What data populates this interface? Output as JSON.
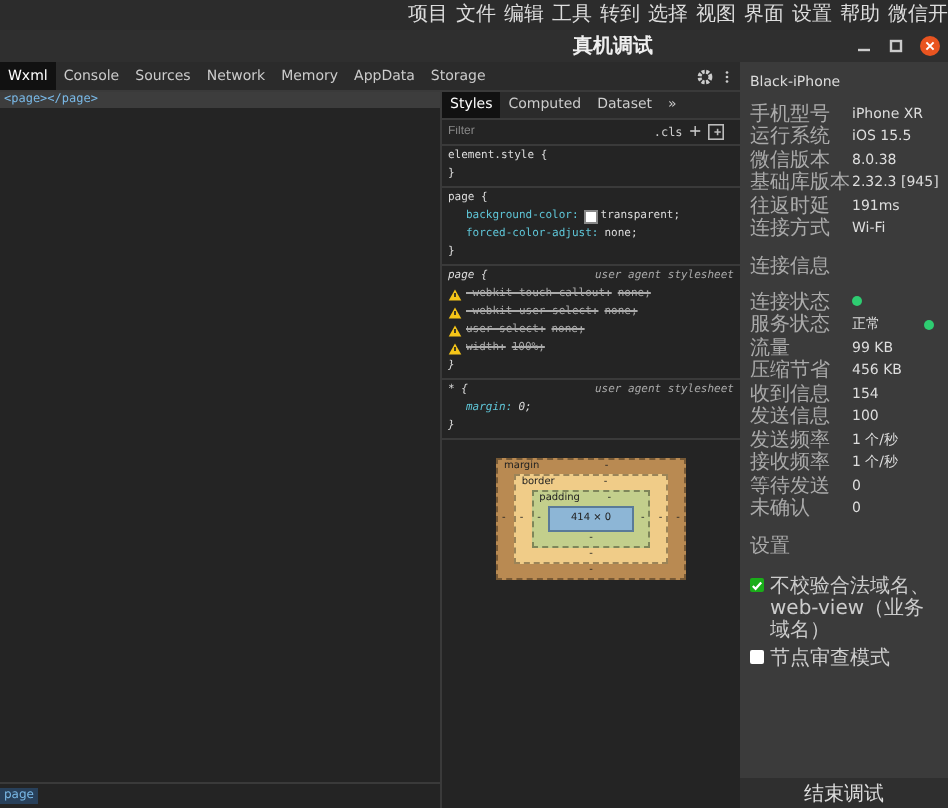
{
  "menu_bar": {
    "items": [
      "项目",
      "文件",
      "编辑",
      "工具",
      "转到",
      "选择",
      "视图",
      "界面",
      "设置",
      "帮助",
      "微信开"
    ]
  },
  "window": {
    "title": "真机调试"
  },
  "tabs": [
    {
      "label": "Wxml",
      "selected": true
    },
    {
      "label": "Console",
      "selected": false
    },
    {
      "label": "Sources",
      "selected": false
    },
    {
      "label": "Network",
      "selected": false
    },
    {
      "label": "Memory",
      "selected": false
    },
    {
      "label": "AppData",
      "selected": false
    },
    {
      "label": "Storage",
      "selected": false
    }
  ],
  "wxml": {
    "line": "<page></page>",
    "breadcrumb": "page"
  },
  "styles_tabs": [
    {
      "label": "Styles",
      "selected": true
    },
    {
      "label": "Computed",
      "selected": false
    },
    {
      "label": "Dataset",
      "selected": false
    },
    {
      "label": "»",
      "selected": false
    }
  ],
  "filter": {
    "placeholder": "Filter",
    "cls": ".cls",
    "add": "+"
  },
  "rules": [
    {
      "selector": "element.style {",
      "close": "}"
    },
    {
      "selector": "page {",
      "decls": [
        {
          "prop": "background-color:",
          "value": "transparent;",
          "swatch": true,
          "struck": false,
          "warning": false
        },
        {
          "prop": "forced-color-adjust:",
          "value": "none;",
          "swatch": false,
          "struck": false,
          "warning": false
        }
      ],
      "close": "}"
    },
    {
      "selector": "page {",
      "origin": "user agent stylesheet",
      "decls": [
        {
          "prop": "-webkit-touch-callout:",
          "value": "none;",
          "swatch": false,
          "struck": true,
          "warning": true
        },
        {
          "prop": "-webkit-user-select:",
          "value": "none;",
          "swatch": false,
          "struck": true,
          "warning": true
        },
        {
          "prop": "user-select:",
          "value": "none;",
          "swatch": false,
          "struck": true,
          "warning": true
        },
        {
          "prop": "width:",
          "value": "100%;",
          "swatch": false,
          "struck": true,
          "warning": true
        }
      ],
      "close": "}"
    },
    {
      "selector": "* {",
      "origin": "user agent stylesheet",
      "decls": [
        {
          "prop": "margin:",
          "value": "0;",
          "swatch": false,
          "struck": false,
          "warning": false
        }
      ],
      "close": "}"
    }
  ],
  "box_model": {
    "layers": [
      {
        "label": "margin",
        "top": "-",
        "left": "-"
      },
      {
        "label": "border",
        "top": "-",
        "left": "-"
      },
      {
        "label": "padding",
        "top": "-",
        "left": "-"
      }
    ],
    "content": "414 × 0",
    "right_values": [
      "-",
      "-",
      "-"
    ],
    "bottom_values": [
      "-",
      "-",
      "-"
    ]
  },
  "device": {
    "name": "Black-iPhone",
    "info": [
      {
        "label": "手机型号",
        "value": "iPhone XR"
      },
      {
        "label": "运行系统",
        "value": "iOS 15.5"
      },
      {
        "label": "微信版本",
        "value": "8.0.38"
      },
      {
        "label": "基础库版本",
        "value": "2.32.3 [945]"
      },
      {
        "label": "往返时延",
        "value": "191ms"
      },
      {
        "label": "连接方式",
        "value": "Wi-Fi"
      }
    ],
    "connection_title": "连接信息",
    "connection": [
      {
        "label": "连接状态",
        "kind": "dot",
        "color": "#2ecc71"
      },
      {
        "label": "服务状态",
        "value": "正常",
        "kind": "dot",
        "color": "#2ecc71"
      },
      {
        "label": "流量",
        "value": "99 KB",
        "kind": "text"
      },
      {
        "label": "压缩节省",
        "value": "456 KB",
        "kind": "text"
      },
      {
        "label": "收到信息",
        "value": "154",
        "kind": "text"
      },
      {
        "label": "发送信息",
        "value": "100",
        "kind": "text"
      },
      {
        "label": "发送频率",
        "value": "1 个/秒",
        "kind": "text"
      },
      {
        "label": "接收频率",
        "value": "1 个/秒",
        "kind": "text"
      },
      {
        "label": "等待发送",
        "value": "0",
        "kind": "text"
      },
      {
        "label": "未确认",
        "value": "0",
        "kind": "text"
      }
    ],
    "settings_title": "设置",
    "settings": [
      {
        "label": "不校验合法域名、web-view（业务域名）",
        "checked": true
      },
      {
        "label": "节点审查模式",
        "checked": false
      }
    ],
    "end_button": "结束调试"
  }
}
